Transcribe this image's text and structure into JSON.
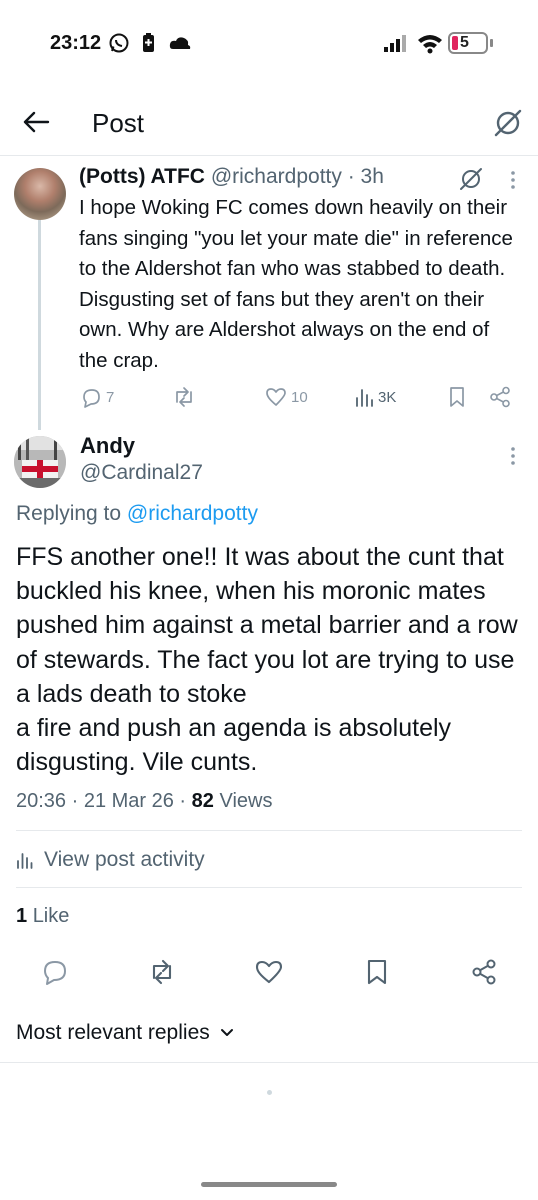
{
  "status_bar": {
    "time": "23:12",
    "battery_level": "5",
    "icons": [
      "whatsapp-icon",
      "battery-saver-icon",
      "cloud-icon",
      "signal-icon",
      "wifi-icon",
      "battery-icon"
    ]
  },
  "header": {
    "title": "Post",
    "back_icon": "arrow-left-icon",
    "grok_icon": "grok-icon"
  },
  "parent_post": {
    "display_name": "(Potts) ATFC",
    "handle": "@richardpotty",
    "time": "· 3h",
    "text": "I hope Woking FC comes down  heavily on their fans singing \"you let your mate die\" in reference to the Aldershot fan who was stabbed to death. Disgusting set of fans but they aren't on their own. Why are Aldershot always on the end of the crap.",
    "replies": "7",
    "reposts": "",
    "likes": "10",
    "views": "3K"
  },
  "reply_post": {
    "display_name": "Andy",
    "handle": "@Cardinal27",
    "replying_prefix": "Replying to",
    "replying_to": "@richardpotty",
    "text": "FFS another one!! It was about the cunt that buckled his knee, when his moronic mates pushed him against a metal barrier and a row  of stewards. The fact you lot are trying to use a lads death to stoke\na fire and push an agenda is absolutely disgusting. Vile cunts.",
    "timestamp": "20:36 · 21 Mar 26 ·",
    "view_count": "82",
    "views_label": "Views",
    "activity_label": "View post activity",
    "like_count": "1",
    "like_label": "Like"
  },
  "replies_section": {
    "sort_label": "Most relevant replies"
  },
  "colors": {
    "text_primary": "#0f1419",
    "text_secondary": "#536471",
    "link": "#1d9bf0",
    "divider": "#e6e9ec",
    "battery_low": "#e0245e"
  }
}
